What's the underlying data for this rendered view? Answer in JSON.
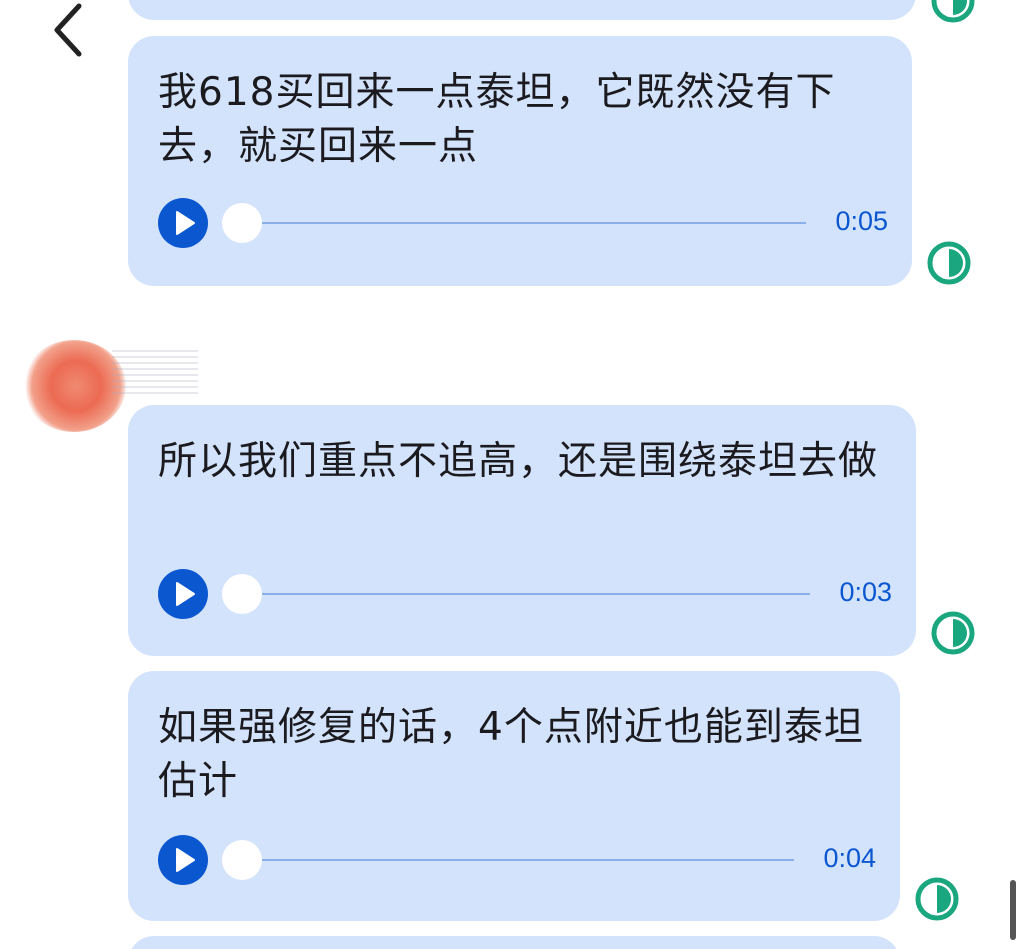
{
  "colors": {
    "bubble": "#d3e3fc",
    "accent": "#0b57d0",
    "status": "#1aa67f"
  },
  "nav": {
    "back_icon": "chevron-left-icon"
  },
  "messages": [
    {
      "text": "我618买回来一点泰坦，它既然没有下去，就买回来一点",
      "duration": "0:05",
      "status_icon": "half-circle-status-icon"
    },
    {
      "text": "所以我们重点不追高，还是围绕泰坦去做",
      "duration": "0:03",
      "status_icon": "half-circle-status-icon"
    },
    {
      "text": "如果强修复的话，4个点附近也能到泰坦估计",
      "duration": "0:04",
      "status_icon": "half-circle-status-icon"
    }
  ]
}
